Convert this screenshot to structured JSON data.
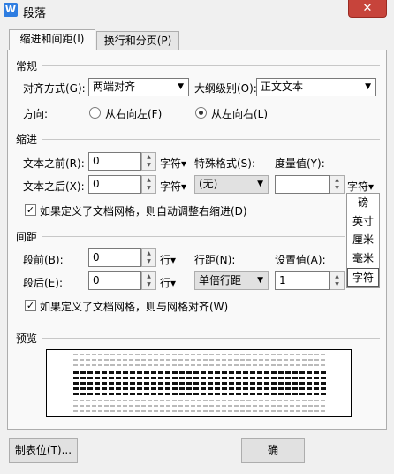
{
  "window": {
    "title": "段落",
    "app_icon": "W",
    "close": "✕"
  },
  "tabs": [
    {
      "label": "缩进和间距(I)"
    },
    {
      "label": "换行和分页(P)"
    }
  ],
  "general": {
    "heading": "常规",
    "alignment_label": "对齐方式(G):",
    "alignment_value": "两端对齐",
    "outline_label": "大纲级别(O):",
    "outline_value": "正文文本",
    "direction_label": "方向:",
    "rtl_label": "从右向左(F)",
    "ltr_label": "从左向右(L)"
  },
  "indent": {
    "heading": "缩进",
    "before_label": "文本之前(R):",
    "before_value": "0",
    "before_unit": "字符▾",
    "after_label": "文本之后(X):",
    "after_value": "0",
    "after_unit": "字符▾",
    "special_label": "特殊格式(S):",
    "special_value": "(无)",
    "measure_label": "度量值(Y):",
    "measure_value": "",
    "measure_unit": "字符▾",
    "auto_adjust_label": "如果定义了文档网格，则自动调整右缩进(D)"
  },
  "unit_dropdown": {
    "options": [
      "磅",
      "英寸",
      "厘米",
      "毫米",
      "字符"
    ],
    "selected": "字符"
  },
  "spacing": {
    "heading": "间距",
    "before_label": "段前(B):",
    "before_value": "0",
    "before_unit": "行▾",
    "after_label": "段后(E):",
    "after_value": "0",
    "after_unit": "行▾",
    "line_label": "行距(N):",
    "line_value": "单倍行距",
    "set_label": "设置值(A):",
    "set_value": "1",
    "set_unit": "倍",
    "snap_label": "如果定义了文档网格，则与网格对齐(W)"
  },
  "preview": {
    "heading": "预览"
  },
  "footer": {
    "tabs_button": "制表位(T)...",
    "ok_button": "确"
  }
}
